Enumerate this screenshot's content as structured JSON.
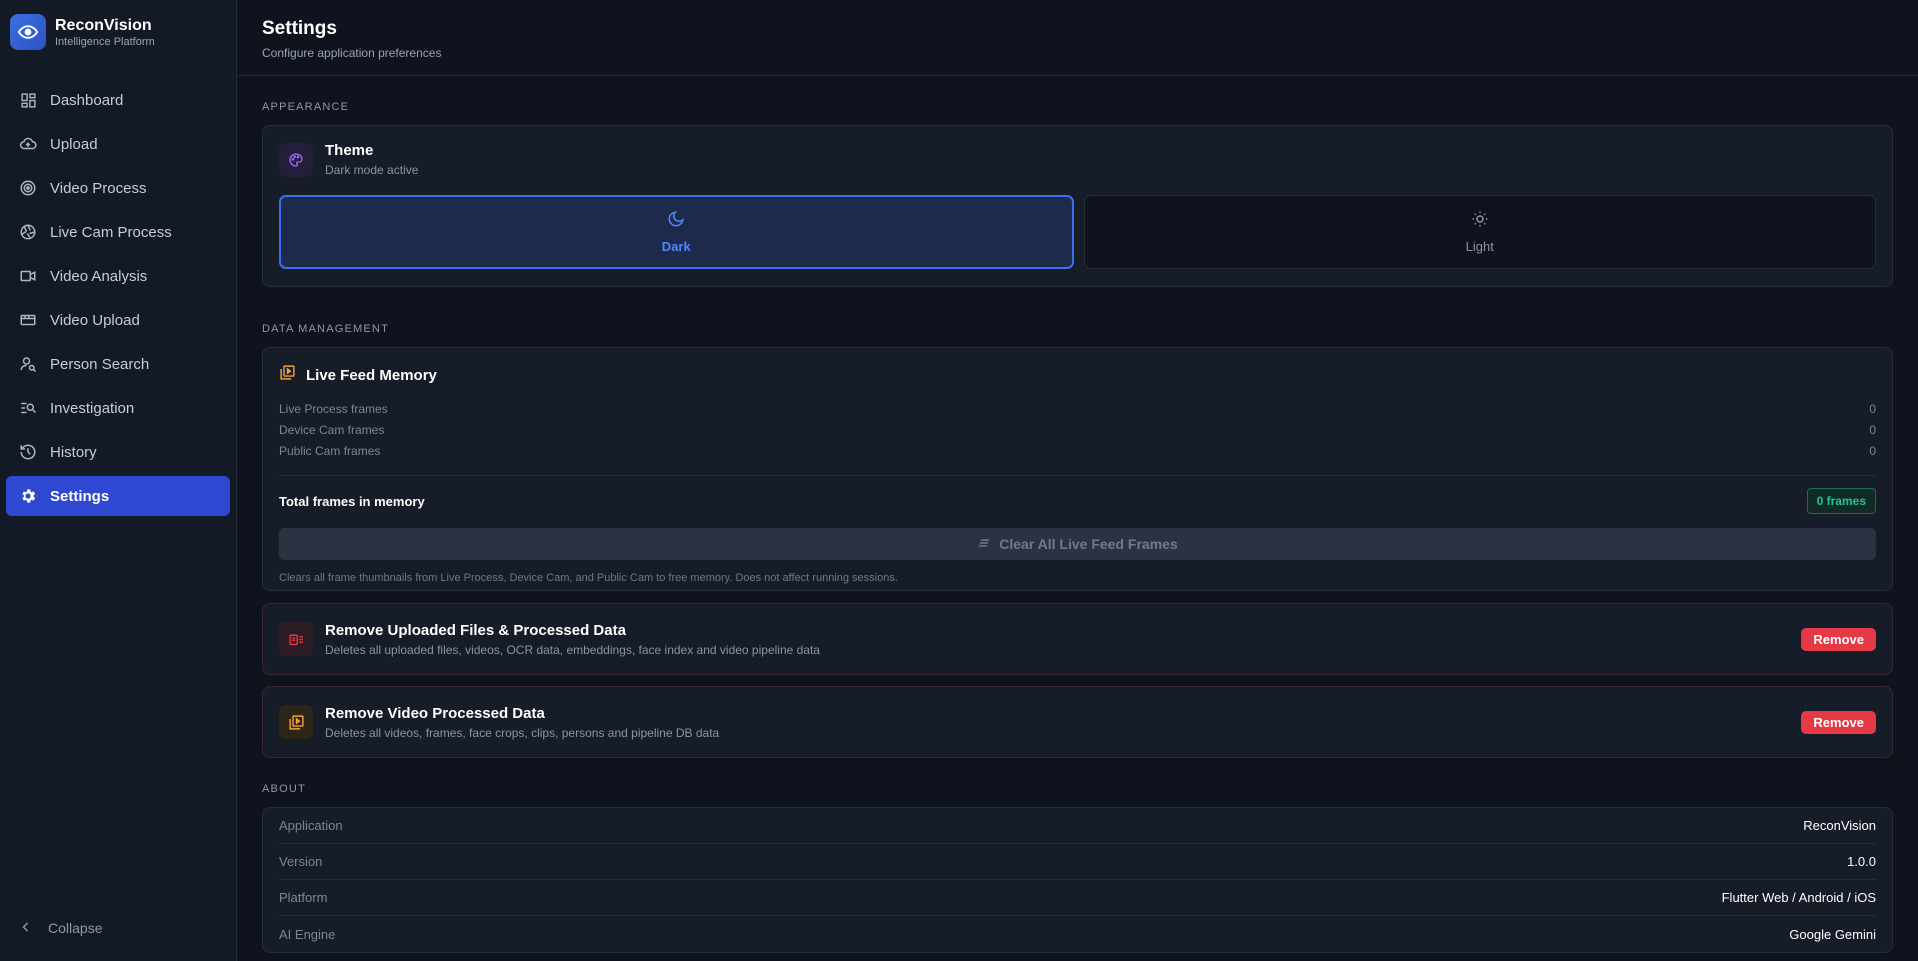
{
  "brand": {
    "name": "ReconVision",
    "subtitle": "Intelligence Platform"
  },
  "nav": {
    "items": [
      {
        "label": "Dashboard",
        "icon": "dashboard-icon",
        "active": false
      },
      {
        "label": "Upload",
        "icon": "cloud-upload-icon",
        "active": false
      },
      {
        "label": "Video Process",
        "icon": "target-icon",
        "active": false
      },
      {
        "label": "Live Cam Process",
        "icon": "camera-shutter-icon",
        "active": false
      },
      {
        "label": "Video Analysis",
        "icon": "video-camera-icon",
        "active": false
      },
      {
        "label": "Video Upload",
        "icon": "video-file-icon",
        "active": false
      },
      {
        "label": "Person Search",
        "icon": "person-search-icon",
        "active": false
      },
      {
        "label": "Investigation",
        "icon": "manage-search-icon",
        "active": false
      },
      {
        "label": "History",
        "icon": "history-icon",
        "active": false
      },
      {
        "label": "Settings",
        "icon": "gear-icon",
        "active": true
      }
    ],
    "collapse_label": "Collapse"
  },
  "header": {
    "title": "Settings",
    "subtitle": "Configure application preferences"
  },
  "appearance": {
    "section_label": "APPEARANCE",
    "title": "Theme",
    "subtitle": "Dark mode active",
    "options": [
      {
        "label": "Dark",
        "icon": "moon-icon",
        "selected": true
      },
      {
        "label": "Light",
        "icon": "sun-icon",
        "selected": false
      }
    ]
  },
  "data_management": {
    "section_label": "DATA MANAGEMENT",
    "memory": {
      "title": "Live Feed Memory",
      "rows": [
        {
          "label": "Live Process frames",
          "value": "0"
        },
        {
          "label": "Device Cam frames",
          "value": "0"
        },
        {
          "label": "Public Cam frames",
          "value": "0"
        }
      ],
      "total_label": "Total frames in memory",
      "total_badge": "0 frames",
      "clear_label": "Clear All Live Feed Frames",
      "note": "Clears all frame thumbnails from Live Process, Device Cam, and Public Cam to free memory. Does not affect running sessions."
    },
    "remove_uploaded": {
      "title": "Remove Uploaded Files & Processed Data",
      "subtitle": "Deletes all uploaded files, videos, OCR data, embeddings, face index and video pipeline data",
      "button": "Remove"
    },
    "remove_video": {
      "title": "Remove Video Processed Data",
      "subtitle": "Deletes all videos, frames, face crops, clips, persons and pipeline DB data",
      "button": "Remove"
    }
  },
  "about": {
    "section_label": "ABOUT",
    "rows": [
      {
        "key": "Application",
        "value": "ReconVision"
      },
      {
        "key": "Version",
        "value": "1.0.0"
      },
      {
        "key": "Platform",
        "value": "Flutter Web / Android / iOS"
      },
      {
        "key": "AI Engine",
        "value": "Google Gemini"
      }
    ]
  },
  "colors": {
    "accent": "#2f48d2",
    "selected_border": "#3b6ff0",
    "danger": "#e63946",
    "success": "#22c58b",
    "warning": "#f0a43a",
    "purple": "#a06cf0"
  }
}
